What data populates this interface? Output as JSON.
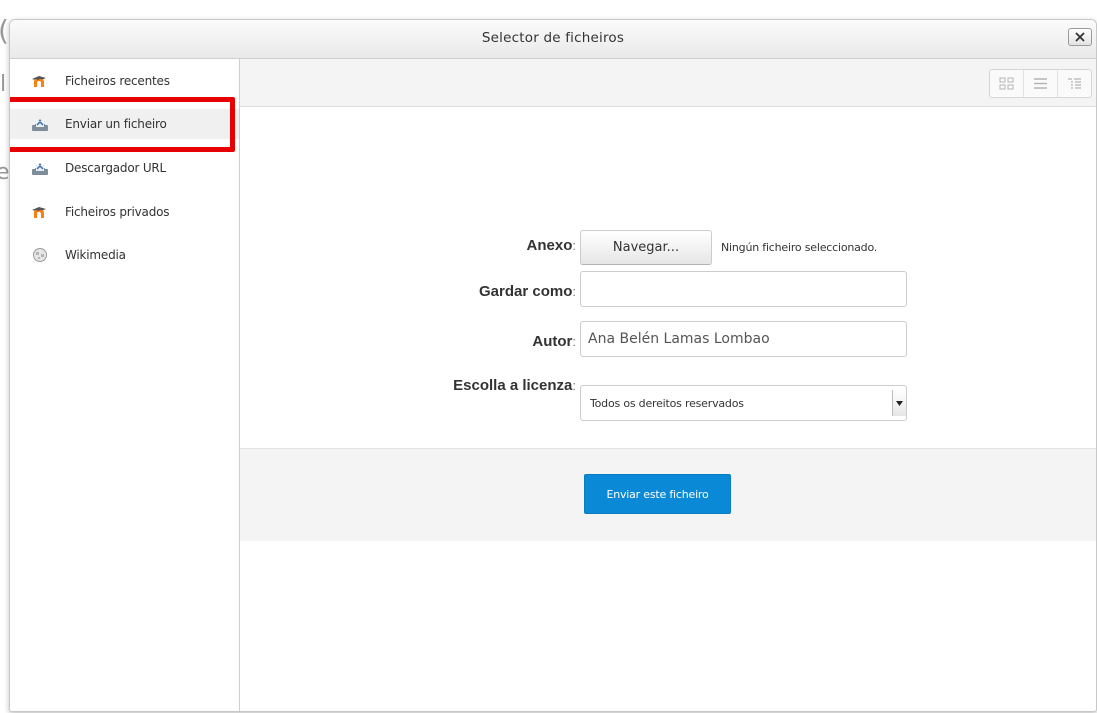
{
  "dialog": {
    "title": "Selector de ficheiros",
    "close_icon": "close-icon"
  },
  "sidebar": {
    "items": [
      {
        "label": "Ficheiros recentes",
        "icon": "moodle-logo-icon"
      },
      {
        "label": "Enviar un ficheiro",
        "icon": "upload-icon",
        "selected": true
      },
      {
        "label": "Descargador URL",
        "icon": "url-download-icon"
      },
      {
        "label": "Ficheiros privados",
        "icon": "moodle-logo-icon"
      },
      {
        "label": "Wikimedia",
        "icon": "wikimedia-globe-icon"
      }
    ]
  },
  "toolbar": {
    "view_buttons": [
      "icons-view-icon",
      "list-view-icon",
      "tree-view-icon"
    ]
  },
  "form": {
    "attachment": {
      "label": "Anexo",
      "browse_label": "Navegar...",
      "status": "Ningún ficheiro seleccionado."
    },
    "save_as": {
      "label": "Gardar como",
      "value": ""
    },
    "author": {
      "label": "Autor",
      "value": "Ana Belén Lamas Lombao"
    },
    "license": {
      "label": "Escolla a licenza",
      "selected": "Todos os dereitos reservados"
    },
    "submit_label": "Enviar este ficheiro"
  },
  "colors": {
    "highlight": "#e60000",
    "submit_bg": "#0a8ad6",
    "moodle_orange": "#f98012"
  }
}
